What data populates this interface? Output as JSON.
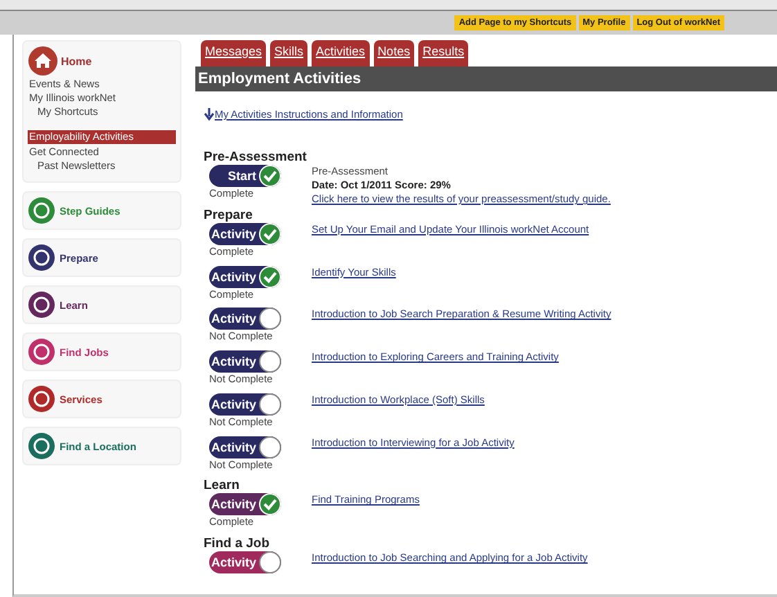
{
  "header_links": [
    "Add Page to my Shortcuts",
    "My Profile",
    "Log Out of workNet"
  ],
  "sidebar": {
    "home": "Home",
    "links": [
      {
        "label": "Events & News",
        "indent": false,
        "selected": false
      },
      {
        "label": "My Illinois workNet",
        "indent": false,
        "selected": false
      },
      {
        "label": "My Shortcuts",
        "indent": true,
        "selected": false
      },
      {
        "label": "Employability Activities",
        "indent": false,
        "selected": true
      },
      {
        "label": "Get Connected",
        "indent": false,
        "selected": false
      },
      {
        "label": "Past Newsletters",
        "indent": true,
        "selected": false
      }
    ],
    "nav": [
      {
        "label": "Step Guides",
        "color": "#2e8b3a"
      },
      {
        "label": "Prepare",
        "color": "#33336e"
      },
      {
        "label": "Learn",
        "color": "#64285f"
      },
      {
        "label": "Find Jobs",
        "color": "#c0306a"
      },
      {
        "label": "Services",
        "color": "#b02a2a"
      },
      {
        "label": "Find a Location",
        "color": "#1a6e5e"
      }
    ]
  },
  "tabs": [
    "Messages",
    "Skills",
    "Activities",
    "Notes",
    "Results"
  ],
  "page_title": "Employment Activities",
  "info_link": "My Activities Instructions and Information",
  "sections": [
    {
      "title": "Pre-Assessment",
      "color": "#2a2a62",
      "activities": [
        {
          "button": "Start",
          "complete": true,
          "status": "Complete",
          "heading": "Pre-Assessment",
          "details": "Date: Oct 1/2011 Score: 29%",
          "link": "Click here to view the results of your preassessment/study guide."
        }
      ]
    },
    {
      "title": "Prepare",
      "color": "#2a2a62",
      "activities": [
        {
          "button": "Activity",
          "complete": true,
          "status": "Complete",
          "link": "Set Up Your Email and Update Your Illinois workNet Account"
        },
        {
          "button": "Activity",
          "complete": true,
          "status": "Complete",
          "link": "Identify Your Skills"
        },
        {
          "button": "Activity",
          "complete": false,
          "status": "Not Complete",
          "link": "Introduction to Job Search Preparation & Resume Writing Activity"
        },
        {
          "button": "Activity",
          "complete": false,
          "status": "Not Complete",
          "link": "Introduction to Exploring Careers and Training Activity"
        },
        {
          "button": "Activity",
          "complete": false,
          "status": "Not Complete",
          "link": "Introduction to Workplace (Soft) Skills"
        },
        {
          "button": "Activity",
          "complete": false,
          "status": "Not Complete",
          "link": "Introduction to Interviewing for a Job Activity"
        }
      ]
    },
    {
      "title": "Learn",
      "color": "#5e2a5e",
      "activities": [
        {
          "button": "Activity",
          "complete": true,
          "status": "Complete",
          "link": "Find Training Programs"
        }
      ]
    },
    {
      "title": "Find a Job",
      "color": "#a02a5e",
      "activities": [
        {
          "button": "Activity",
          "complete": false,
          "link": "Introduction to Job Searching and Applying for a Job Activity"
        }
      ]
    }
  ]
}
